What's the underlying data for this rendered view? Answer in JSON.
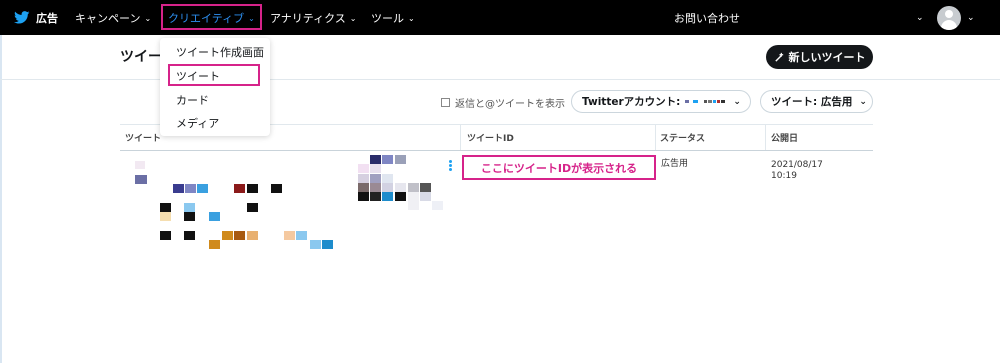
{
  "topnav": {
    "brand": "広告",
    "items": [
      {
        "label": "キャンペーン"
      },
      {
        "label": "クリエイティブ"
      },
      {
        "label": "アナリティクス"
      },
      {
        "label": "ツール"
      }
    ],
    "support": "お問い合わせ"
  },
  "page": {
    "title": "ツイー",
    "new_tweet_label": "新しいツイート"
  },
  "dropdown": {
    "items": [
      "ツイート作成画面",
      "ツイート",
      "カード",
      "メディア"
    ]
  },
  "filters": {
    "checkbox_label": "返信と@ツイートを表示",
    "account_label": "Twitterアカウント: ",
    "tweet_type_label": "ツイート: 広告用"
  },
  "table": {
    "headers": [
      "ツイート",
      "ツイートID",
      "ステータス",
      "公開日"
    ],
    "row": {
      "callout": "ここにツイートIDが表示される",
      "status": "広告用",
      "date": "2021/08/17",
      "time": "10:19"
    }
  },
  "colors": {
    "highlight": "#d6238a",
    "accent": "#2d8ff0",
    "topbar": "#000000"
  }
}
